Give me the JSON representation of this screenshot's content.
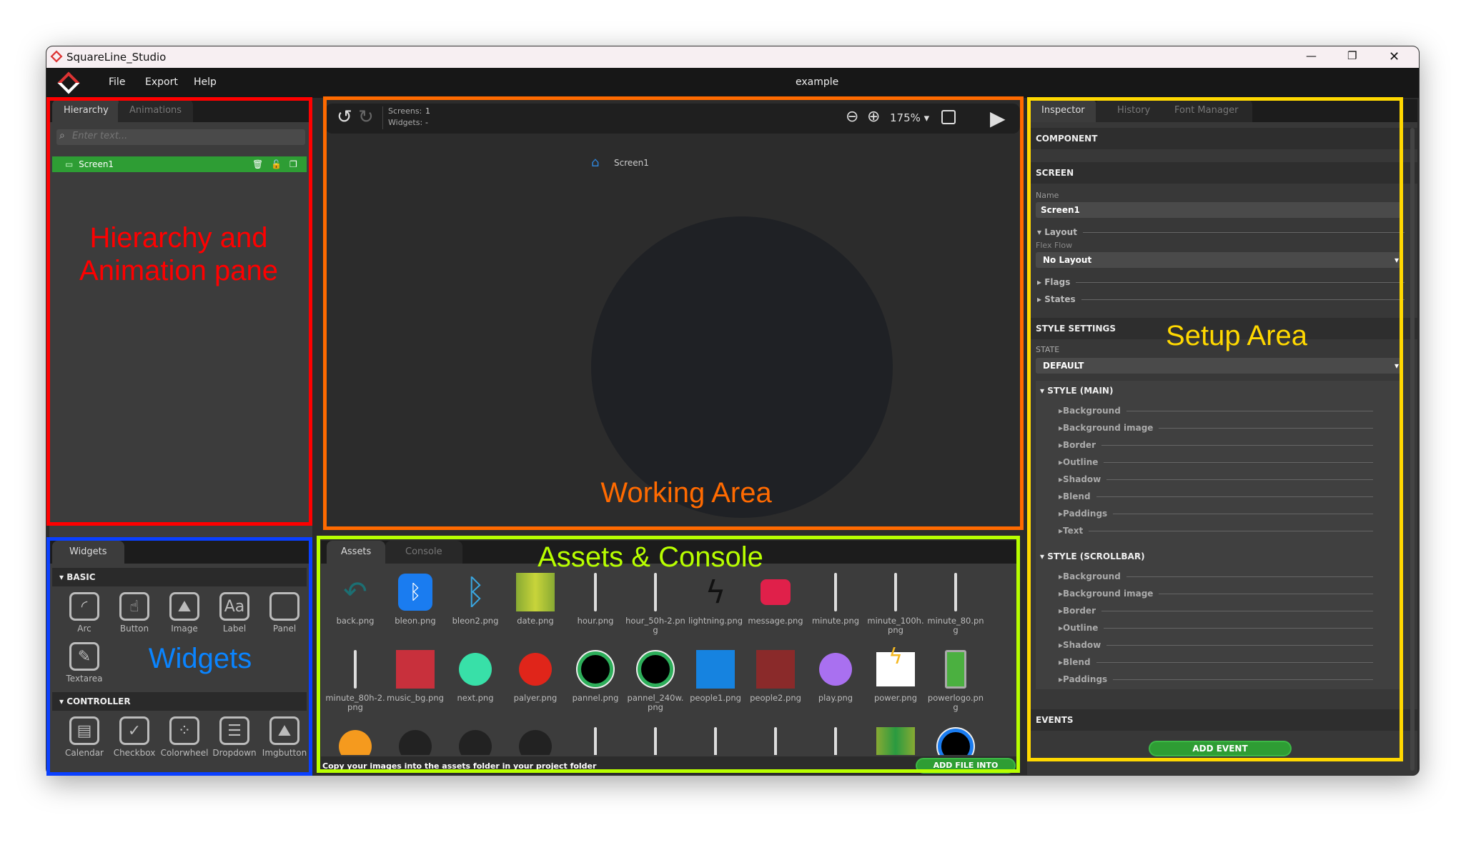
{
  "window": {
    "title": "SquareLine_Studio",
    "project": "example",
    "minimize": "—",
    "maximize": "❐",
    "close": "✕"
  },
  "menu": [
    "File",
    "Export",
    "Help"
  ],
  "hierarchy": {
    "tabs": [
      "Hierarchy",
      "Animations"
    ],
    "search_placeholder": "Enter text...",
    "items": [
      {
        "label": "Screen1",
        "selected": true
      }
    ]
  },
  "canvas": {
    "screens_label": "Screens:",
    "screens_value": "1",
    "widgets_label": "Widgets:",
    "widgets_value": "-",
    "zoom": "175%",
    "screen_label": "Screen1",
    "screen_color": "#1f2125"
  },
  "widgets": {
    "tab": "Widgets",
    "groups": [
      {
        "name": "BASIC",
        "items": [
          {
            "label": "Arc",
            "icon": "arc-icon",
            "glyph": "◜"
          },
          {
            "label": "Button",
            "icon": "button-icon",
            "glyph": "☝"
          },
          {
            "label": "Image",
            "icon": "image-icon",
            "glyph": "⛰"
          },
          {
            "label": "Label",
            "icon": "label-icon",
            "glyph": "Aa"
          },
          {
            "label": "Panel",
            "icon": "panel-icon",
            "glyph": ""
          },
          {
            "label": "Textarea",
            "icon": "textarea-icon",
            "glyph": "✎"
          }
        ]
      },
      {
        "name": "CONTROLLER",
        "items": [
          {
            "label": "Calendar",
            "icon": "calendar-icon",
            "glyph": "▤"
          },
          {
            "label": "Checkbox",
            "icon": "checkbox-icon",
            "glyph": "✓"
          },
          {
            "label": "Colorwheel",
            "icon": "palette-icon",
            "glyph": "⁘"
          },
          {
            "label": "Dropdown",
            "icon": "dropdown-icon",
            "glyph": "☰"
          },
          {
            "label": "Imgbutton",
            "icon": "imgbutton-icon",
            "glyph": "⛰"
          }
        ]
      }
    ]
  },
  "assets": {
    "tabs": [
      "Assets",
      "Console"
    ],
    "footer": "Copy your images into the assets folder in your project folder",
    "add_button": "ADD FILE INTO ASSETS",
    "items": [
      {
        "label": "back.png",
        "color": "#1c6f73",
        "kind": "arrow"
      },
      {
        "label": "bleon.png",
        "color": "#1a7cf0",
        "kind": "bt-fill"
      },
      {
        "label": "bleon2.png",
        "color": "#3aa6e0",
        "kind": "bt"
      },
      {
        "label": "date.png",
        "color": "#c8d43a",
        "kind": "grad"
      },
      {
        "label": "hour.png",
        "color": "#dddddd",
        "kind": "needle"
      },
      {
        "label": "hour_50h-2.png",
        "color": "#dddddd",
        "kind": "needle"
      },
      {
        "label": "lightning.png",
        "color": "#111111",
        "kind": "bolt"
      },
      {
        "label": "message.png",
        "color": "#e0204a",
        "kind": "msg"
      },
      {
        "label": "minute.png",
        "color": "#dddddd",
        "kind": "needle"
      },
      {
        "label": "minute_100h.png",
        "color": "#dddddd",
        "kind": "needle"
      },
      {
        "label": "minute_80.png",
        "color": "#dddddd",
        "kind": "needle"
      },
      {
        "label": "minute_80h-2.png",
        "color": "#dddddd",
        "kind": "needle"
      },
      {
        "label": "music_bg.png",
        "color": "#c8303c",
        "kind": "square"
      },
      {
        "label": "next.png",
        "color": "#38e0a8",
        "kind": "circle"
      },
      {
        "label": "palyer.png",
        "color": "#e0251a",
        "kind": "circle"
      },
      {
        "label": "pannel.png",
        "color": "#2dae5a",
        "kind": "ring"
      },
      {
        "label": "pannel_240w.png",
        "color": "#2dae5a",
        "kind": "ring"
      },
      {
        "label": "people1.png",
        "color": "#1683e0",
        "kind": "square"
      },
      {
        "label": "people2.png",
        "color": "#8a2a2a",
        "kind": "square"
      },
      {
        "label": "play.png",
        "color": "#a970f0",
        "kind": "circle"
      },
      {
        "label": "power.png",
        "color": "#f5b820",
        "kind": "square-white"
      },
      {
        "label": "powerlogo.png",
        "color": "#4bb040",
        "kind": "battery"
      },
      {
        "label": "",
        "color": "#f59a1e",
        "kind": "circle"
      },
      {
        "label": "",
        "color": "#222222",
        "kind": "circle"
      },
      {
        "label": "",
        "color": "#222222",
        "kind": "circle"
      },
      {
        "label": "",
        "color": "#222222",
        "kind": "circle"
      },
      {
        "label": "",
        "color": "#dddddd",
        "kind": "needle"
      },
      {
        "label": "",
        "color": "#dddddd",
        "kind": "needle"
      },
      {
        "label": "",
        "color": "#dddddd",
        "kind": "needle"
      },
      {
        "label": "",
        "color": "#dddddd",
        "kind": "needle"
      },
      {
        "label": "",
        "color": "#dddddd",
        "kind": "needle"
      },
      {
        "label": "",
        "color": "#2a9a40",
        "kind": "grad"
      },
      {
        "label": "",
        "color": "#1a7cf0",
        "kind": "ring"
      }
    ]
  },
  "inspector": {
    "tabs": [
      "Inspector",
      "History",
      "Font Manager"
    ],
    "component": "COMPONENT",
    "screen": "SCREEN",
    "name_label": "Name",
    "name_value": "Screen1",
    "layout": "Layout",
    "flex_flow_label": "Flex Flow",
    "flex_flow_value": "No Layout",
    "flags": "Flags",
    "states": "States",
    "style_settings": "STYLE SETTINGS",
    "state_label": "STATE",
    "state_value": "DEFAULT",
    "style_main": {
      "title": "STYLE (MAIN)",
      "items": [
        "Background",
        "Background image",
        "Border",
        "Outline",
        "Shadow",
        "Blend",
        "Paddings",
        "Text"
      ]
    },
    "style_scrollbar": {
      "title": "STYLE (SCROLLBAR)",
      "items": [
        "Background",
        "Background image",
        "Border",
        "Outline",
        "Shadow",
        "Blend",
        "Paddings"
      ]
    },
    "events": "EVENTS",
    "add_event": "ADD EVENT"
  },
  "annotations": [
    {
      "label": "Hierarchy and Animation pane",
      "color": "#ff0000"
    },
    {
      "label": "Working Area",
      "color": "#ff6a00"
    },
    {
      "label": "Assets & Console",
      "color": "#b8ff00"
    },
    {
      "label": "Widgets",
      "color": "#0a84ff"
    },
    {
      "label": "Setup Area",
      "color": "#ffd800"
    }
  ],
  "colors": {
    "accent_green": "#2e9d34",
    "selection": "#2e9d34"
  }
}
